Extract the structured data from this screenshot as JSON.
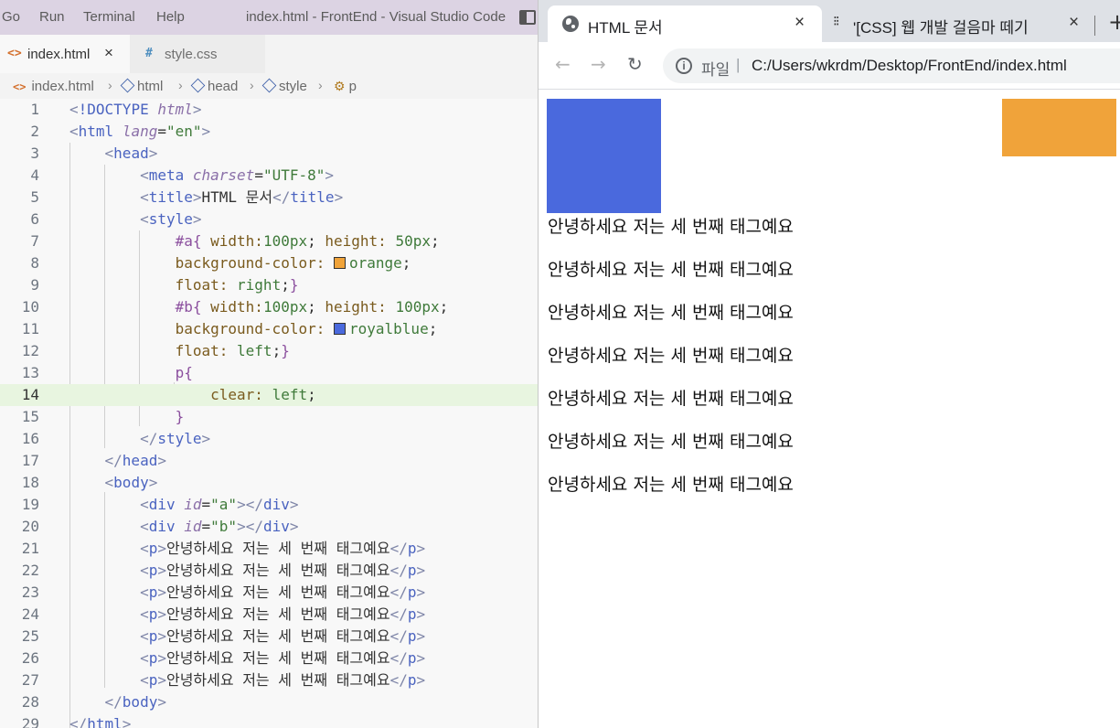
{
  "vscode": {
    "menu": [
      "Go",
      "Run",
      "Terminal",
      "Help"
    ],
    "window_title": "index.html - FrontEnd - Visual Studio Code",
    "tabs": [
      {
        "label": "index.html",
        "icon": "<>",
        "active": true,
        "close": "×"
      },
      {
        "label": "style.css",
        "icon": "#",
        "active": false
      }
    ],
    "breadcrumb": [
      "index.html",
      "html",
      "head",
      "style",
      "p"
    ],
    "current_line": 14,
    "colors": {
      "orange": "#f0a33a",
      "royalblue": "#4a69dd",
      "tag": "#4a63c0",
      "current_line_bg": "#e8f5e0"
    },
    "code": {
      "line1_doctype": "!DOCTYPE",
      "line1_html": "html",
      "html_tag": "html",
      "lang_attr": "lang",
      "lang_val": "\"en\"",
      "head_tag": "head",
      "meta_tag": "meta",
      "charset_attr": "charset",
      "charset_val": "\"UTF-8\"",
      "title_tag": "title",
      "title_text": "HTML 문서",
      "style_tag": "style",
      "a_sel": "#a{",
      "a_width_prop": "width:",
      "a_width_val": "100px",
      "a_height_prop": "height:",
      "a_height_val": "50px",
      "bg_prop": "background-color:",
      "orange_val": "orange",
      "float_prop": "float:",
      "right_val": "right",
      "b_sel": "#b{",
      "b_width_val": "100px",
      "b_height_val": "100px",
      "royalblue_val": "royalblue",
      "left_val": "left",
      "p_sel": "p{",
      "clear_prop": "clear:",
      "clear_val": "left",
      "close_brace": "}",
      "body_tag": "body",
      "div_tag": "div",
      "id_attr": "id",
      "id_a": "\"a\"",
      "id_b": "\"b\"",
      "p_tag": "p",
      "p_text": "안녕하세요 저는 세 번째 태그예요"
    }
  },
  "chrome": {
    "tabs": [
      {
        "label": "HTML 문서",
        "icon": "globe-icon",
        "close": "×"
      },
      {
        "label": "'[CSS] 웹 개발 걸음마 떼기",
        "icon": "dots-icon",
        "close": "×"
      }
    ],
    "new_tab": "+",
    "nav": {
      "back": "←",
      "forward": "→",
      "reload": "↻"
    },
    "address": {
      "scheme": "파일",
      "separator": "|",
      "url": "C:/Users/wkrdm/Desktop/FrontEnd/index.html"
    },
    "page": {
      "box_a_color": "#f0a33a",
      "box_b_color": "#4a69dd",
      "paragraphs": [
        "안녕하세요 저는 세 번째 태그예요",
        "안녕하세요 저는 세 번째 태그예요",
        "안녕하세요 저는 세 번째 태그예요",
        "안녕하세요 저는 세 번째 태그예요",
        "안녕하세요 저는 세 번째 태그예요",
        "안녕하세요 저는 세 번째 태그예요",
        "안녕하세요 저는 세 번째 태그예요"
      ]
    }
  }
}
